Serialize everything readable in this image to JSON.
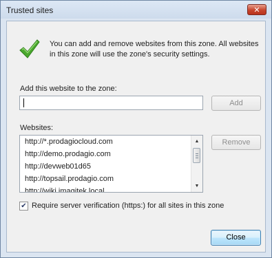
{
  "dialog": {
    "title": "Trusted sites",
    "close_glyph": "✕",
    "info_text": "You can add and remove websites from this zone. All websites in this zone will use the zone's security settings.",
    "add_label": "Add this website to the zone:",
    "add_input_value": "",
    "add_button": "Add",
    "websites_label": "Websites:",
    "remove_button": "Remove",
    "websites": [
      "http://*.prodagiocloud.com",
      "http://demo.prodagio.com",
      "http://devweb01d65",
      "http://topsail.prodagio.com",
      "http://wiki.imagitek.local"
    ],
    "require_verification_label": "Require server verification (https:) for all sites in this zone",
    "require_verification_checked": true,
    "close_button": "Close"
  },
  "icons": {
    "success": "checkmark-icon",
    "scroll_up": "▲",
    "scroll_down": "▼",
    "checkbox_mark": "✔"
  },
  "colors": {
    "check_icon": "#4aa82e",
    "title_bar": "#d3e0f0",
    "close_button": "#c7452d"
  }
}
